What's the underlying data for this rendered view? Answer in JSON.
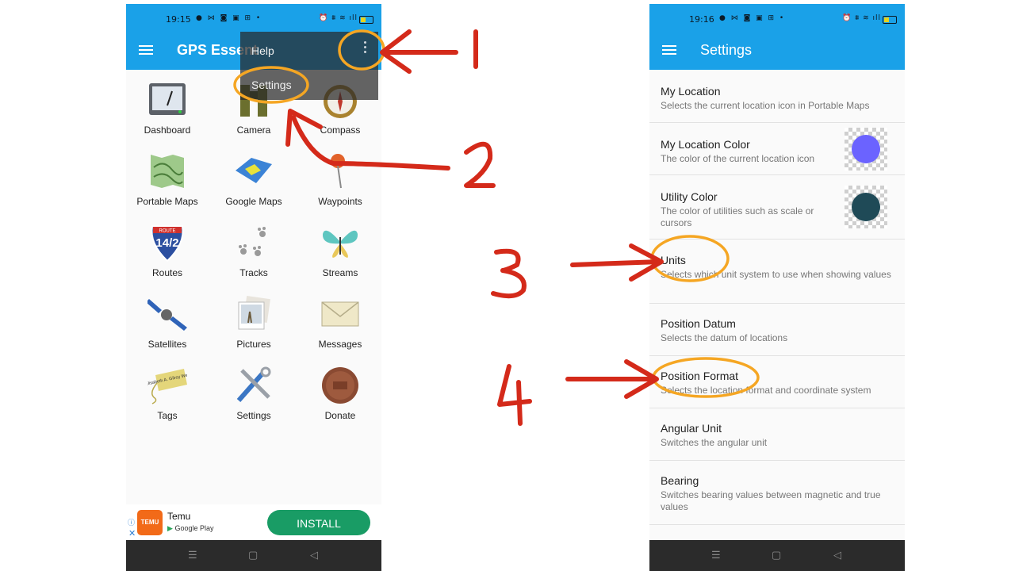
{
  "left_phone": {
    "status": {
      "time": "19:15",
      "icons_left": "● ⋈ ◙ ▣ ⊞ •",
      "icons_right": "⏰ ⩩ ≋ ıll"
    },
    "appbar": {
      "title": "GPS Essent",
      "menu_icon": "hamburger-menu-icon",
      "overflow_icon": "overflow-menu-icon"
    },
    "popup": {
      "items": [
        "Help",
        "Settings"
      ]
    },
    "grid": [
      {
        "label": "Dashboard",
        "icon": "dashboard-icon"
      },
      {
        "label": "Camera",
        "icon": "camera-icon"
      },
      {
        "label": "Compass",
        "icon": "compass-icon"
      },
      {
        "label": "Portable Maps",
        "icon": "portable-maps-icon"
      },
      {
        "label": "Google Maps",
        "icon": "google-maps-icon"
      },
      {
        "label": "Waypoints",
        "icon": "waypoint-pin-icon"
      },
      {
        "label": "Routes",
        "icon": "route-shield-icon"
      },
      {
        "label": "Tracks",
        "icon": "paw-tracks-icon"
      },
      {
        "label": "Streams",
        "icon": "butterfly-icon"
      },
      {
        "label": "Satellites",
        "icon": "satellite-icon"
      },
      {
        "label": "Pictures",
        "icon": "photos-icon"
      },
      {
        "label": "Messages",
        "icon": "envelope-icon"
      },
      {
        "label": "Tags",
        "icon": "tag-icon"
      },
      {
        "label": "Settings",
        "icon": "tools-icon"
      },
      {
        "label": "Donate",
        "icon": "penny-icon"
      }
    ],
    "route_shield": {
      "top": "ROUTE",
      "number": "14/2"
    },
    "tag_text": "Mrs. Elisabeth A. Gilroy West Sussex",
    "ad": {
      "logo": "TEMU",
      "name": "Temu",
      "store": "Google Play",
      "install": "INSTALL",
      "info": "ⓘ",
      "close": "✕"
    },
    "nav": {
      "recent": "☰",
      "home": "▢",
      "back": "◁"
    }
  },
  "right_phone": {
    "status": {
      "time": "19:16",
      "icons_left": "● ⋈ ◙ ▣ ⊞ •",
      "icons_right": "⏰ ⩩ ≋ ıll"
    },
    "appbar": {
      "title": "Settings",
      "menu_icon": "hamburger-menu-icon"
    },
    "settings": [
      {
        "title": "My Location",
        "subtitle": "Selects the current location icon in Portable Maps"
      },
      {
        "title": "My Location Color",
        "subtitle": "The color of the current location icon",
        "color": "#6b63ff"
      },
      {
        "title": "Utility Color",
        "subtitle": "The color of utilities such as scale or cursors",
        "color": "#1f4a57"
      },
      {
        "title": "Units",
        "subtitle": "Selects which unit system to use when showing values"
      },
      {
        "title": "Position Datum",
        "subtitle": "Selects the datum of locations"
      },
      {
        "title": "Position Format",
        "subtitle": "Selects the location format and coordinate system"
      },
      {
        "title": "Angular Unit",
        "subtitle": "Switches the angular unit"
      },
      {
        "title": "Bearing",
        "subtitle": "Switches bearing values between magnetic and true values"
      }
    ],
    "nav": {
      "recent": "☰",
      "home": "▢",
      "back": "◁"
    }
  },
  "annotations": {
    "labels": [
      "1",
      "2",
      "3",
      "4"
    ],
    "arrow_color": "#d42a1a",
    "highlight_color": "#f5a623"
  },
  "colors": {
    "appbar": "#1aa1e8",
    "install": "#199c65"
  }
}
